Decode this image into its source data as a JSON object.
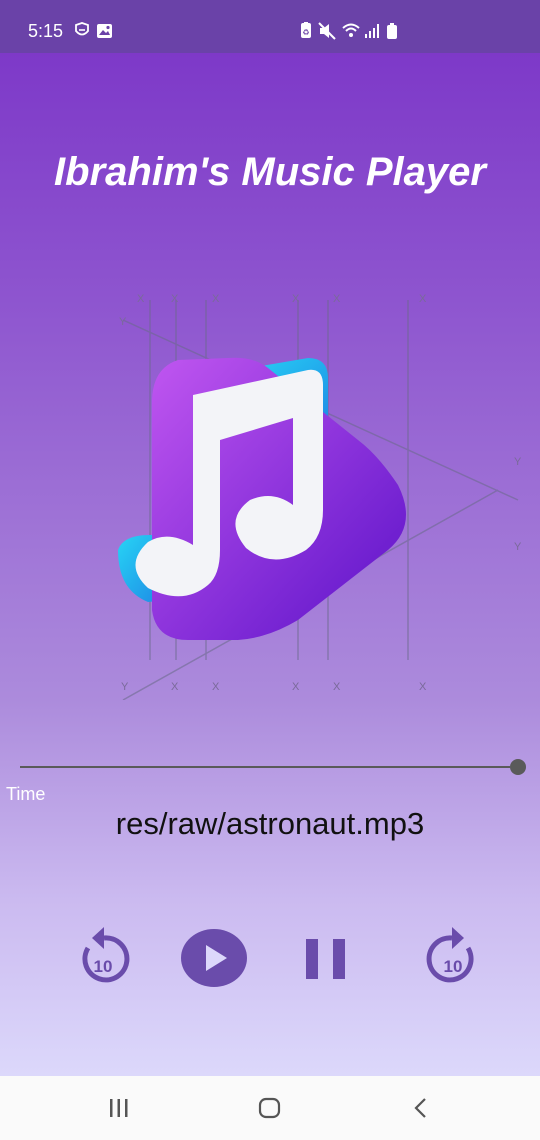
{
  "status_bar": {
    "time": "5:15",
    "icons": [
      "shield-icon",
      "image-icon",
      "battery-saver-icon",
      "mute-icon",
      "wifi-icon",
      "signal-icon",
      "battery-icon"
    ]
  },
  "app": {
    "title": "Ibrahim's Music Player",
    "time_label": "Time",
    "track_name": "res/raw/astronaut.mp3",
    "seek_progress_percent": 100
  },
  "controls": {
    "rewind_seconds": "10",
    "forward_seconds": "10",
    "icons": [
      "rewind-10-icon",
      "play-icon",
      "pause-icon",
      "forward-10-icon"
    ]
  },
  "colors": {
    "accent": "#6a4cab",
    "status_bar": "#6a42a8",
    "seek": "#5a5a5a"
  },
  "nav_bar": {
    "icons": [
      "recents-icon",
      "home-icon",
      "back-icon"
    ]
  }
}
